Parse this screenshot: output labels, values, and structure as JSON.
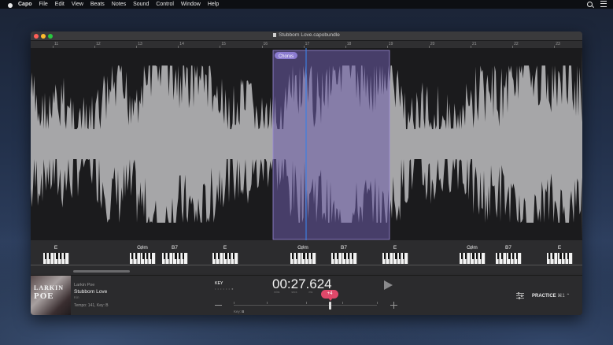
{
  "menubar": {
    "app_name": "Capo",
    "items": [
      "File",
      "Edit",
      "View",
      "Beats",
      "Notes",
      "Sound",
      "Control",
      "Window",
      "Help"
    ]
  },
  "window": {
    "title": "Stubborn Love.capobundle",
    "traffic_lights": [
      "#ff5f57",
      "#febc2e",
      "#28c840"
    ]
  },
  "ruler": {
    "bars": [
      "11",
      "12",
      "13",
      "14",
      "15",
      "16",
      "17",
      "18",
      "19",
      "20",
      "21",
      "22",
      "23"
    ]
  },
  "region": {
    "label": "Chorus",
    "color": "#8b7bd0"
  },
  "chords": [
    "E",
    "G♯m",
    "B7",
    "E",
    "G♯m",
    "B7",
    "E",
    "G♯m",
    "B7",
    "E"
  ],
  "track": {
    "artist": "Larkin Poe",
    "song": "Stubborn Love",
    "album": "Kin",
    "tempo_key": "Tempo: 141, Key: B",
    "art_text": [
      "LARKIN",
      "POE"
    ]
  },
  "transport": {
    "key_label": "KEY",
    "key_dots": "• • • • • • ●",
    "time": "00:27.624",
    "units": "mins secs ms",
    "transpose_value": "+4",
    "key_value_prefix": "Key:",
    "key_value": "B",
    "practice_label": "PRACTICE",
    "practice_shortcut": "⌘1 ⌃"
  },
  "colors": {
    "accent": "#e0486a",
    "playhead": "#3d7fe0",
    "waveform": "#1b1b1d"
  }
}
